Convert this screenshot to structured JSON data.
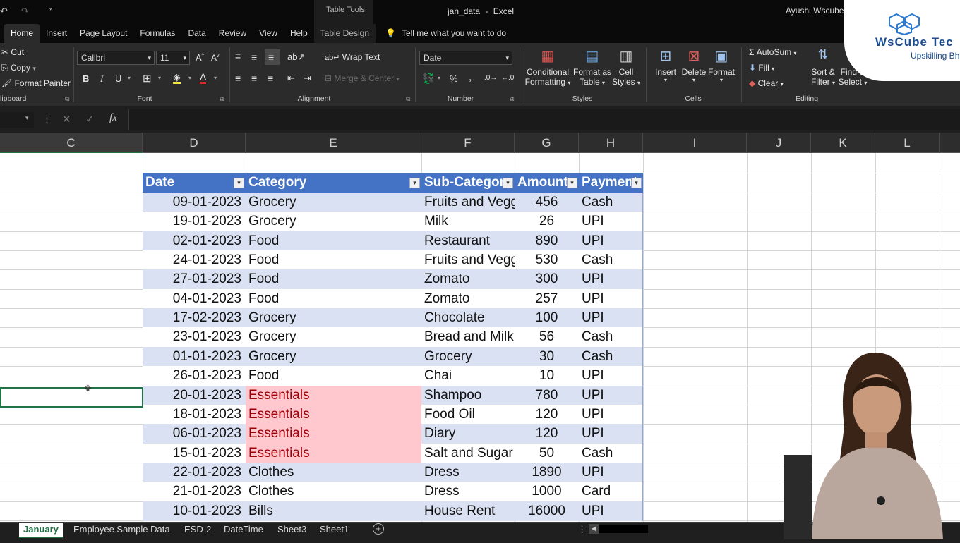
{
  "window": {
    "file_name": "jan_data",
    "sep": "-",
    "app_name": "Excel",
    "context_group": "Table Tools",
    "user": "Ayushi Wscube"
  },
  "ribbon_tabs": [
    "Home",
    "Insert",
    "Page Layout",
    "Formulas",
    "Data",
    "Review",
    "View",
    "Help"
  ],
  "context_tab": "Table Design",
  "tell_me": "Tell me what you want to do",
  "clipboard": {
    "cut": "Cut",
    "copy": "Copy",
    "format_painter": "Format Painter",
    "label": "lipboard"
  },
  "font": {
    "name": "Calibri",
    "size": "11",
    "label": "Font",
    "bold": "B",
    "italic": "I",
    "underline": "U"
  },
  "alignment": {
    "wrap_text": "Wrap Text",
    "merge_center": "Merge & Center",
    "label": "Alignment"
  },
  "number": {
    "format": "Date",
    "percent": "%",
    "comma": ",",
    "label": "Number"
  },
  "styles": {
    "conditional_1": "Conditional",
    "conditional_2": "Formatting",
    "format_table_1": "Format as",
    "format_table_2": "Table",
    "cell_styles_1": "Cell",
    "cell_styles_2": "Styles",
    "label": "Styles"
  },
  "cells": {
    "insert": "Insert",
    "delete": "Delete",
    "format": "Format",
    "label": "Cells"
  },
  "editing": {
    "autosum": "AutoSum",
    "fill": "Fill",
    "clear": "Clear",
    "sort_1": "Sort &",
    "sort_2": "Filter",
    "find_1": "Find &",
    "find_2": "Select",
    "label": "Editing"
  },
  "formula_bar": {
    "fx": "fx"
  },
  "columns": [
    "C",
    "D",
    "E",
    "F",
    "G",
    "H",
    "I",
    "J",
    "K",
    "L"
  ],
  "table": {
    "headers": [
      "Date",
      "Category",
      "Sub-Categor",
      "Amount",
      "Payment"
    ],
    "rows": [
      {
        "date": "09-01-2023",
        "category": "Grocery",
        "sub": "Fruits and Vegg",
        "amount": "456",
        "payment": "Cash",
        "hl": false
      },
      {
        "date": "19-01-2023",
        "category": "Grocery",
        "sub": "Milk",
        "amount": "26",
        "payment": "UPI",
        "hl": false
      },
      {
        "date": "02-01-2023",
        "category": "Food",
        "sub": "Restaurant",
        "amount": "890",
        "payment": "UPI",
        "hl": false
      },
      {
        "date": "24-01-2023",
        "category": "Food",
        "sub": "Fruits and Vegg",
        "amount": "530",
        "payment": "Cash",
        "hl": false
      },
      {
        "date": "27-01-2023",
        "category": "Food",
        "sub": "Zomato",
        "amount": "300",
        "payment": "UPI",
        "hl": false
      },
      {
        "date": "04-01-2023",
        "category": "Food",
        "sub": "Zomato",
        "amount": "257",
        "payment": "UPI",
        "hl": false
      },
      {
        "date": "17-02-2023",
        "category": "Grocery",
        "sub": "Chocolate",
        "amount": "100",
        "payment": "UPI",
        "hl": false
      },
      {
        "date": "23-01-2023",
        "category": "Grocery",
        "sub": "Bread and Milk",
        "amount": "56",
        "payment": "Cash",
        "hl": false
      },
      {
        "date": "01-01-2023",
        "category": "Grocery",
        "sub": "Grocery",
        "amount": "30",
        "payment": "Cash",
        "hl": false
      },
      {
        "date": "26-01-2023",
        "category": "Food",
        "sub": "Chai",
        "amount": "10",
        "payment": "UPI",
        "hl": false
      },
      {
        "date": "20-01-2023",
        "category": "Essentials",
        "sub": "Shampoo",
        "amount": "780",
        "payment": "UPI",
        "hl": true
      },
      {
        "date": "18-01-2023",
        "category": "Essentials",
        "sub": "Food Oil",
        "amount": "120",
        "payment": "UPI",
        "hl": true
      },
      {
        "date": "06-01-2023",
        "category": "Essentials",
        "sub": "Diary",
        "amount": "120",
        "payment": "UPI",
        "hl": true
      },
      {
        "date": "15-01-2023",
        "category": "Essentials",
        "sub": "Salt and Sugar",
        "amount": "50",
        "payment": "Cash",
        "hl": true
      },
      {
        "date": "22-01-2023",
        "category": "Clothes",
        "sub": "Dress",
        "amount": "1890",
        "payment": "UPI",
        "hl": false
      },
      {
        "date": "21-01-2023",
        "category": "Clothes",
        "sub": "Dress",
        "amount": "1000",
        "payment": "Card",
        "hl": false
      },
      {
        "date": "10-01-2023",
        "category": "Bills",
        "sub": "House Rent",
        "amount": "16000",
        "payment": "UPI",
        "hl": false
      }
    ]
  },
  "sheet_tabs": [
    "January",
    "Employee Sample Data",
    "ESD-2",
    "DateTime",
    "Sheet3",
    "Sheet1"
  ],
  "logo": {
    "brand": "WsCube Tec",
    "tagline": "Upskilling Bh"
  },
  "colors": {
    "table_header": "#4472c4",
    "band": "#d9e1f2",
    "highlight": "#ffc7ce",
    "highlight_text": "#9c0006",
    "excel_green": "#217346"
  }
}
